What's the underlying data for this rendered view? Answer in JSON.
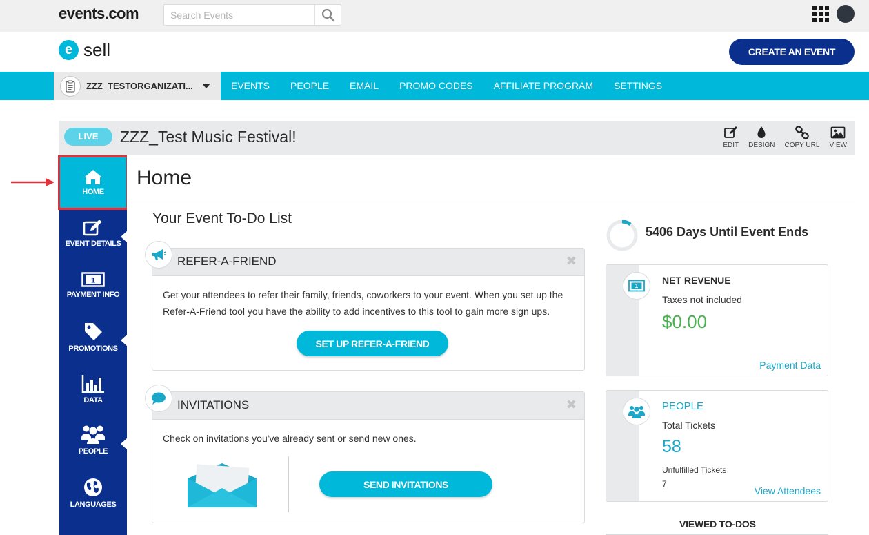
{
  "app": {
    "brand": "events.com"
  },
  "search": {
    "placeholder": "Search Events"
  },
  "header": {
    "product": "sell",
    "logo_letter": "e",
    "create_button": "CREATE AN EVENT"
  },
  "nav": {
    "organization": "ZZZ_TESTORGANIZATI...",
    "items": [
      "EVENTS",
      "PEOPLE",
      "EMAIL",
      "PROMO CODES",
      "AFFILIATE PROGRAM",
      "SETTINGS"
    ]
  },
  "event": {
    "status": "LIVE",
    "title": "ZZZ_Test Music Festival!",
    "actions": [
      "EDIT",
      "DESIGN",
      "COPY URL",
      "VIEW"
    ]
  },
  "sidebar": {
    "items": [
      {
        "label": "HOME",
        "icon": "home-icon",
        "active": true
      },
      {
        "label": "EVENT DETAILS",
        "icon": "edit-icon"
      },
      {
        "label": "PAYMENT INFO",
        "icon": "money-icon"
      },
      {
        "label": "PROMOTIONS",
        "icon": "tag-icon"
      },
      {
        "label": "DATA",
        "icon": "bar-chart-icon"
      },
      {
        "label": "PEOPLE",
        "icon": "users-icon"
      },
      {
        "label": "LANGUAGES",
        "icon": "globe-icon"
      }
    ]
  },
  "main": {
    "page_title": "Home",
    "todo_title": "Your Event To-Do List",
    "refer": {
      "title": "REFER-A-FRIEND",
      "line1": "Get your attendees to refer their family, friends, coworkers to your event. When you set up the",
      "line2": "Refer-A-Friend tool you have the ability to add incentives to this tool to gain more sign ups.",
      "button": "SET UP REFER-A-FRIEND"
    },
    "invitations": {
      "title": "INVITATIONS",
      "text": "Check on invitations you've already sent or send new ones.",
      "button": "SEND INVITATIONS"
    }
  },
  "right": {
    "days_text": "5406 Days Until Event Ends",
    "revenue": {
      "title": "NET REVENUE",
      "subtitle": "Taxes not included",
      "amount": "$0.00",
      "link": "Payment Data"
    },
    "people": {
      "title": "PEOPLE",
      "total_label": "Total Tickets",
      "total_value": "58",
      "unfulfilled_label": "Unfulfilled Tickets",
      "unfulfilled_value": "7",
      "link": "View Attendees"
    },
    "viewed_title": "VIEWED TO-DOS"
  },
  "colors": {
    "cyan": "#00b8d9",
    "navy": "#0a2f8c",
    "green": "#4caf50",
    "highlight": "#e0323b"
  }
}
